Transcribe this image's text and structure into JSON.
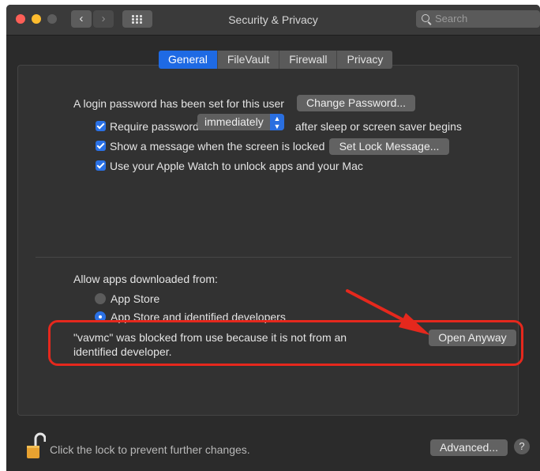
{
  "window": {
    "title": "Security & Privacy",
    "search_placeholder": "Search"
  },
  "tabs": [
    "General",
    "FileVault",
    "Firewall",
    "Privacy"
  ],
  "general": {
    "login_text": "A login password has been set for this user",
    "change_password_label": "Change Password...",
    "require_password_label": "Require password",
    "require_password_value": "immediately",
    "after_sleep_text": "after sleep or screen saver begins",
    "show_message_label": "Show a message when the screen is locked",
    "set_lock_message_label": "Set Lock Message...",
    "apple_watch_label": "Use your Apple Watch to unlock apps and your Mac",
    "allow_apps_label": "Allow apps downloaded from:",
    "option_app_store": "App Store",
    "option_identified": "App Store and identified developers",
    "blocked_line1": "\"vavmc\" was blocked from use because it is not from an",
    "blocked_line2": "identified developer.",
    "open_anyway_label": "Open Anyway"
  },
  "footer": {
    "lock_text": "Click the lock to prevent further changes.",
    "advanced_label": "Advanced...",
    "help_label": "?"
  },
  "colors": {
    "accent": "#1e6ae4",
    "highlight": "#e5281d"
  },
  "icons": [
    "back-chevron-icon",
    "forward-chevron-icon",
    "grid-icon",
    "search-icon",
    "padlock-icon",
    "arrow-annotation-icon"
  ]
}
